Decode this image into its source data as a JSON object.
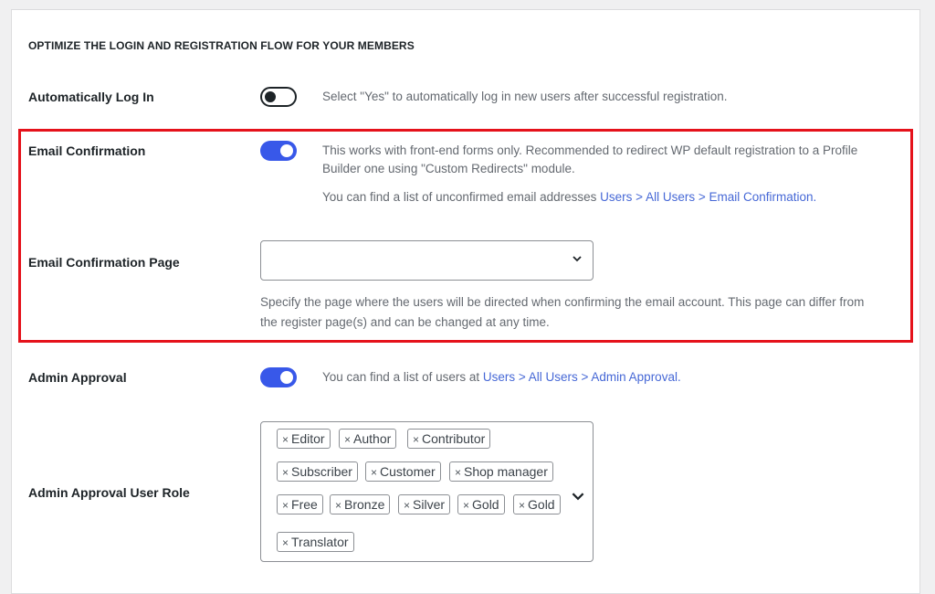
{
  "section_title": "OPTIMIZE THE LOGIN AND REGISTRATION FLOW FOR YOUR MEMBERS",
  "auto_login": {
    "label": "Automatically Log In",
    "enabled": false,
    "description": "Select \"Yes\" to automatically log in new users after successful registration."
  },
  "email_confirmation": {
    "label": "Email Confirmation",
    "enabled": true,
    "description_line1": "This works with front-end forms only. Recommended to redirect WP default registration to a Profile",
    "description_line2": "Builder one using \"Custom Redirects\" module.",
    "list_prefix": "You can find a list of unconfirmed email addresses ",
    "list_link": "Users > All Users > Email Confirmation."
  },
  "email_confirmation_page": {
    "label": "Email Confirmation Page",
    "selected_value": "",
    "help_line1": "Specify the page where the users will be directed when confirming the email account. This page can differ from",
    "help_line2": "the register page(s) and can be changed at any time."
  },
  "admin_approval": {
    "label": "Admin Approval",
    "enabled": true,
    "list_prefix": "You can find a list of users at ",
    "list_link": "Users > All Users > Admin Approval."
  },
  "admin_approval_user_role": {
    "label": "Admin Approval User Role",
    "remove_symbol": "×",
    "roles": [
      "Editor",
      "Author",
      "Contributor",
      "Subscriber",
      "Customer",
      "Shop manager",
      "Free",
      "Bronze",
      "Silver",
      "Gold",
      "Gold",
      "Translator"
    ]
  },
  "colors": {
    "accent": "#3858e9",
    "link": "#4668d6",
    "highlight_border": "#e5121b"
  }
}
